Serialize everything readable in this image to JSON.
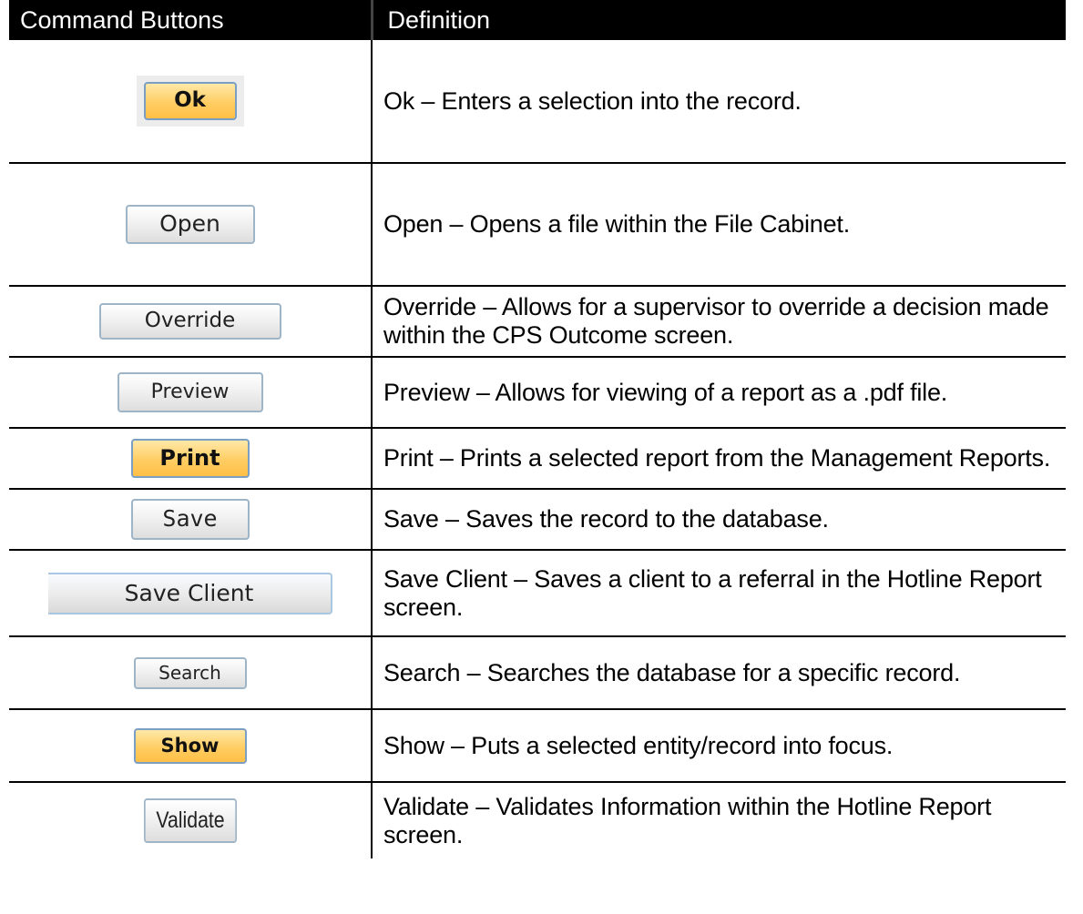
{
  "header": {
    "col1": "Command Buttons",
    "col2": "Definition"
  },
  "rows": [
    {
      "button": "Ok",
      "style": "gold",
      "definition": "Ok – Enters a selection into the record."
    },
    {
      "button": "Open",
      "style": "grey",
      "definition": "Open – Opens a file within the File Cabinet."
    },
    {
      "button": "Override",
      "style": "grey",
      "definition": "Override – Allows for a supervisor to override a decision made within the CPS Outcome screen."
    },
    {
      "button": "Preview",
      "style": "grey",
      "definition": "Preview – Allows for viewing of a report as a .pdf file."
    },
    {
      "button": "Print",
      "style": "gold",
      "definition": "Print – Prints a selected report from the Management Reports."
    },
    {
      "button": "Save",
      "style": "grey",
      "definition": "Save – Saves the record to the database."
    },
    {
      "button": "Save Client",
      "style": "grey",
      "definition": "Save Client – Saves a client to a referral in the Hotline Report screen."
    },
    {
      "button": "Search",
      "style": "grey",
      "definition": "Search – Searches the database for a specific record."
    },
    {
      "button": "Show",
      "style": "gold",
      "definition": "Show – Puts a selected entity/record into focus."
    },
    {
      "button": "Validate",
      "style": "grey",
      "definition": "Validate – Validates Information within the Hotline Report screen."
    }
  ],
  "colors": {
    "header_bg": "#000000",
    "header_text": "#ffffff",
    "gold_button": "#ffcd63",
    "grey_button": "#eeeeee",
    "button_border": "#9eb5c8"
  }
}
